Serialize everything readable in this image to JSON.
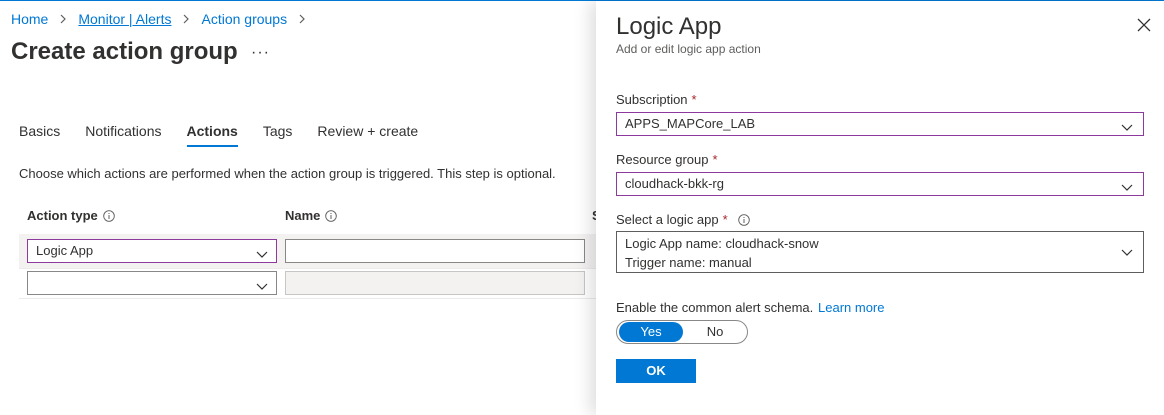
{
  "breadcrumb": {
    "home": "Home",
    "monitor": "Monitor | Alerts",
    "action_groups": "Action groups"
  },
  "page": {
    "title": "Create action group",
    "more": "···"
  },
  "tabs": [
    {
      "label": "Basics"
    },
    {
      "label": "Notifications"
    },
    {
      "label": "Actions"
    },
    {
      "label": "Tags"
    },
    {
      "label": "Review + create"
    }
  ],
  "active_tab": "Actions",
  "description": "Choose which actions are performed when the action group is triggered. This step is optional.",
  "grid": {
    "headers": {
      "action_type": "Action type",
      "name": "Name",
      "col3": "S"
    },
    "rows": [
      {
        "action_type": "Logic App",
        "name": ""
      },
      {
        "action_type": "",
        "name": ""
      }
    ]
  },
  "panel": {
    "title": "Logic App",
    "subtitle": "Add or edit logic app action",
    "subscription_label": "Subscription",
    "subscription_value": "APPS_MAPCore_LAB",
    "resource_group_label": "Resource group",
    "resource_group_value": "cloudhack-bkk-rg",
    "logic_app_label": "Select a logic app",
    "logic_app_line1": "Logic App name: cloudhack-snow",
    "logic_app_line2": "Trigger name: manual",
    "required_mark": "*",
    "schema_label": "Enable the common alert schema.",
    "learn_more": "Learn more",
    "toggle_yes": "Yes",
    "toggle_no": "No",
    "ok": "OK"
  },
  "colors": {
    "accent": "#0078d4",
    "focus_border": "#8c3a9e",
    "required": "#a4262c"
  },
  "icons": [
    "chevron-right-icon",
    "chevron-down-icon",
    "info-icon",
    "close-icon",
    "more-icon"
  ]
}
